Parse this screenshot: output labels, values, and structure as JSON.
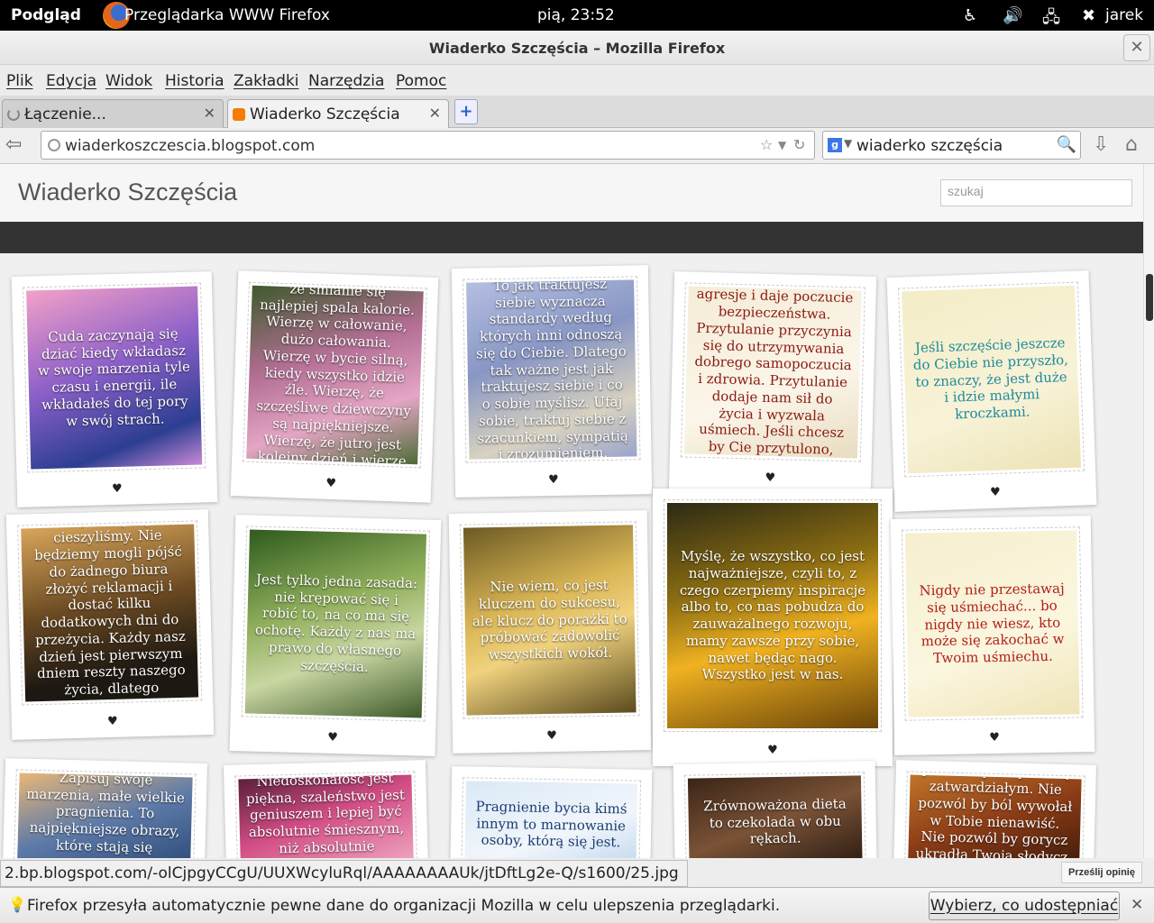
{
  "desktop": {
    "overview": "Podgląd",
    "app_name": "Przeglądarka WWW Firefox",
    "clock": "pią, 23:52",
    "user": "jarek",
    "icons": [
      "accessibility-icon",
      "volume-icon",
      "network-icon",
      "user-status-icon"
    ]
  },
  "window": {
    "title": "Wiaderko Szczęścia – Mozilla Firefox"
  },
  "menu": [
    "Plik",
    "Edycja",
    "Widok",
    "Historia",
    "Zakładki",
    "Narzędzia",
    "Pomoc"
  ],
  "tabs": [
    {
      "label": "Łączenie...",
      "active": false
    },
    {
      "label": "Wiaderko Szczęścia",
      "active": true
    }
  ],
  "new_tab_label": "+",
  "address": {
    "url": "wiaderkoszczescia.blogspot.com"
  },
  "search": {
    "engine": "g",
    "query": "wiaderko szczęścia"
  },
  "site": {
    "title": "Wiaderko Szczęścia",
    "search_placeholder": "szukaj"
  },
  "cards": [
    {
      "quote": "Cuda zaczynają się dziać kiedy wkładasz w swoje marzenia tyle czasu i energii, ile wkładałeś do tej pory w swój strach.",
      "heart": "♥",
      "bg": "linear-gradient(160deg,#f3a0c8,#8a5fc8 45%,#2c3e91 80%,#c889d6)",
      "color": "#ffffff"
    },
    {
      "quote": "Wierzę w róż. Wierzę, że śmianie się najlepiej spala kalorie. Wierzę w całowanie, dużo całowania. Wierzę w bycie silną, kiedy wszystko idzie źle. Wierzę, że szczęśliwe dziewczyny są najpiękniejsze. Wierzę, że jutro jest kolejny dzień i wierzę w cuda.",
      "heart": "♥",
      "bg": "linear-gradient(160deg,#3d5a2c,#b46f95 40%,#e4a6c4 70%,#4c6b35)",
      "color": "#ffffff"
    },
    {
      "quote": "To jak traktujesz siebie wyznacza standardy według których inni odnoszą się do Ciebie. Dlatego tak ważne jest jak traktujesz siebie i co o sobie myślisz. Ufaj sobie, traktuj siebie z szacunkiem, sympatią i zrozumieniem.",
      "heart": "♥",
      "bg": "linear-gradient(160deg,#b4bfe0,#8896c4 40%,#d8d2c0 75%,#9aa4cc)",
      "color": "#ffffff"
    },
    {
      "quote": "Przytulanie zmniejsza agresje i daje poczucie bezpieczeństwa. Przytulanie przyczynia się do utrzymywania dobrego samopoczucia i zdrowia. Przytulanie dodaje nam sił do życia i wyzwala uśmiech. Jeśli chcesz by Cie przytulono, otwórz ramiona.",
      "heart": "♥",
      "bg": "linear-gradient(160deg,#f5ecd7,#fbf6ea 60%,#e8dcc0)",
      "color": "#8a1a12"
    },
    {
      "quote": "Jeśli szczęście jeszcze do Ciebie nie przyszło, to znaczy, że jest duże i idzie małymi kroczkami.",
      "heart": "♥",
      "bg": "linear-gradient(160deg,#f3edc7,#f8f3d8 60%,#ece2b5)",
      "color": "#1f8a9a"
    },
    {
      "quote": "Powinniśmy zrozumieć, że nie dostaniemy powrotem chwili, którą się nie cieszyliśmy. Nie będziemy mogli pójść do żadnego biura złożyć reklamacji i dostać kilku dodatkowych dni do przeżycia. Każdy nasz dzień jest pierwszym dniem reszty naszego życia, dlatego naprawdę musimy zadbać o to, by wszystkie nasze dni były dobre.",
      "heart": "♥",
      "bg": "linear-gradient(170deg,#d8a55a,#6b4a22 45%,#1e1812 80%)",
      "color": "#ffffff"
    },
    {
      "quote": "Jest tylko jedna zasada: nie krępować się i robić to, na co ma się ochotę. Każdy z nas ma prawo do własnego szczęścia.",
      "heart": "♥",
      "bg": "linear-gradient(160deg,#2f5b1e,#8fae5a 40%,#c9d6a2 65%,#3d5a2a)",
      "color": "#ffffff"
    },
    {
      "quote": "Nie wiem, co jest kluczem do sukcesu, ale klucz do porażki to próbować zadowolić wszystkich wokół.",
      "heart": "♥",
      "bg": "linear-gradient(160deg,#6c5a24,#d9b555 40%,#f0d27e 60%,#5a4a1d)",
      "color": "#ffffff"
    },
    {
      "quote": "Myślę, że wszystko, co jest najważniejsze, czyli to, z czego czerpiemy inspiracje albo to, co nas pobudza do zauważalnego rozwoju, mamy zawsze przy sobie, nawet będąc nago. Wszystko jest w nas.",
      "heart": "♥",
      "bg": "linear-gradient(165deg,#2c2a14,#8a6c12 35%,#f0b221 60%,#6a4408)",
      "color": "#ffffff"
    },
    {
      "quote": "Nigdy nie przestawaj się uśmiechać... bo nigdy nie wiesz, kto może się zakochać w Twoim uśmiechu.",
      "heart": "♥",
      "bg": "linear-gradient(160deg,#f6efcf,#fbf6df 60%,#efe4b8)",
      "color": "#b0201a"
    },
    {
      "quote": "Zapisuj swoje marzenia, małe wielkie pragnienia. To najpiękniejsze obrazy, które stają się rzeczywistością.",
      "heart": "♥",
      "bg": "linear-gradient(160deg,#eab776,#5d7aa8 50%,#2c4a78)",
      "color": "#ffffff"
    },
    {
      "quote": "Niedoskonałość jest piękna, szaleństwo jest geniuszem i lepiej być absolutnie śmiesznym, niż absolutnie nudnym.",
      "heart": "♥",
      "bg": "linear-gradient(160deg,#5a1f3c,#d14c84 45%,#f0a8c2)",
      "color": "#ffffff"
    },
    {
      "quote": "Pragnienie bycia kimś innym to marnowanie osoby, którą się jest.",
      "heart": "♥",
      "bg": "linear-gradient(160deg,#dbe9f6,#f1f6fb 60%,#bfd6ee)",
      "color": "#1b3c73"
    },
    {
      "quote": "Zrównoważona dieta to czekolada w obu rękach.",
      "heart": "♥",
      "bg": "linear-gradient(160deg,#3a2517,#7a5236 50%,#2a1b12)",
      "color": "#ffffff"
    },
    {
      "quote": "Bądź łagodny. Nie pozwól by uczynił Cię zatwardziałym. Nie pozwól by ból wywołał w Tobie nienawiść. Nie pozwól by gorycz ukradła Twoją słodycz. Bądź dumny trwając w przekonaniu...",
      "heart": "♥",
      "bg": "linear-gradient(160deg,#c0742a,#8a3b16 50%,#3d1a0a)",
      "color": "#ffffff"
    }
  ],
  "status_link": "2.bp.blogspot.com/-olCjpgyCCgU/UUXWcyluRql/AAAAAAAAUk/jtDftLg2e-Q/s1600/25.jpg",
  "feedback_label": "Prześlij opinię",
  "notification": {
    "message": "Firefox przesyła automatycznie pewne dane do organizacji Mozilla w celu ulepszenia przeglądarki.",
    "button": "Wybierz, co udostępniać",
    "close": "✕"
  }
}
